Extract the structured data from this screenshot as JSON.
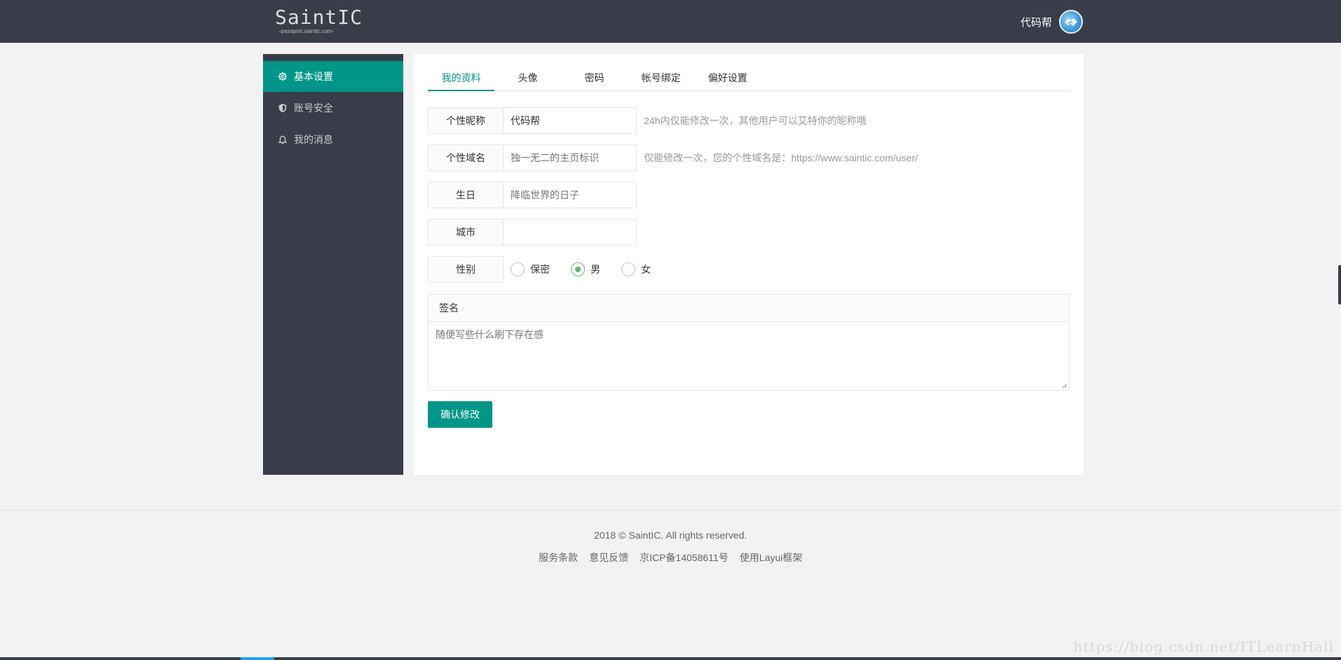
{
  "header": {
    "logo_text": "SaintIC",
    "logo_subtext": "-passport.saintic.com-",
    "username": "代码帮",
    "avatar_icon": "handshake-avatar-icon"
  },
  "sidebar": {
    "items": [
      {
        "label": "基本设置",
        "icon": "gear-icon",
        "active": true
      },
      {
        "label": "账号安全",
        "icon": "shield-icon",
        "active": false
      },
      {
        "label": "我的消息",
        "icon": "bell-icon",
        "active": false
      }
    ]
  },
  "tabs": [
    {
      "label": "我的资料",
      "active": true
    },
    {
      "label": "头像",
      "active": false
    },
    {
      "label": "密码",
      "active": false
    },
    {
      "label": "帐号绑定",
      "active": false
    },
    {
      "label": "偏好设置",
      "active": false
    }
  ],
  "form": {
    "nickname": {
      "label": "个性昵称",
      "value": "代码帮",
      "tip": "24h内仅能修改一次，其他用户可以艾特你的昵称哦"
    },
    "domain": {
      "label": "个性域名",
      "placeholder": "独一无二的主页标识",
      "tip": "仅能修改一次，您的个性域名是：https://www.saintic.com/user/"
    },
    "birthday": {
      "label": "生日",
      "placeholder": "降临世界的日子"
    },
    "city": {
      "label": "城市",
      "value": ""
    },
    "gender": {
      "label": "性别",
      "options": [
        {
          "label": "保密",
          "checked": false
        },
        {
          "label": "男",
          "checked": true
        },
        {
          "label": "女",
          "checked": false
        }
      ]
    },
    "signature": {
      "label": "签名",
      "placeholder": "随便写些什么刷下存在感"
    },
    "submit_label": "确认修改"
  },
  "footer": {
    "copyright": "2018 © SaintIC. All rights reserved.",
    "links": [
      "服务条款",
      "意见反馈",
      "京ICP备14058611号",
      "使用Layui框架"
    ]
  },
  "watermark": "https://blog.csdn.net/ITLearnHall",
  "colors": {
    "accent": "#009688",
    "header_bg": "#393d49",
    "radio_checked": "#5fb878"
  }
}
